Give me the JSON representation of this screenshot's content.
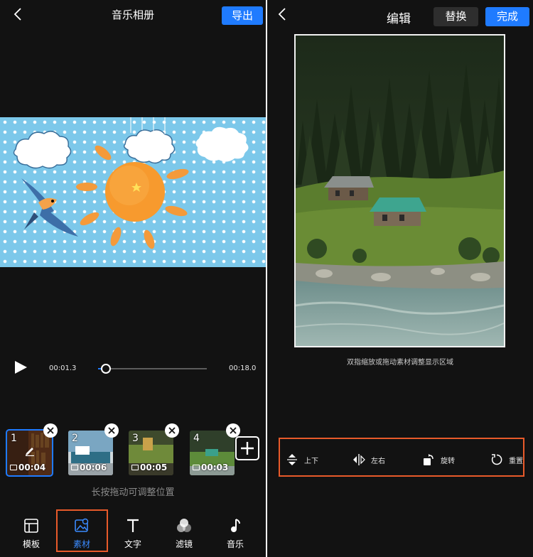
{
  "left": {
    "title": "音乐相册",
    "export_label": "导出",
    "player": {
      "current_time": "00:01.3",
      "total_time": "00:18.0",
      "progress": 0.072
    },
    "clips": [
      {
        "index": "1",
        "duration": "00:04",
        "selected": true
      },
      {
        "index": "2",
        "duration": "00:06",
        "selected": false
      },
      {
        "index": "3",
        "duration": "00:05",
        "selected": false
      },
      {
        "index": "4",
        "duration": "00:03",
        "selected": false
      }
    ],
    "hint": "长按拖动可调整位置",
    "nav": [
      {
        "label": "模板",
        "icon": "template-icon"
      },
      {
        "label": "素材",
        "icon": "media-icon",
        "active": true
      },
      {
        "label": "文字",
        "icon": "text-icon"
      },
      {
        "label": "滤镜",
        "icon": "filter-icon"
      },
      {
        "label": "音乐",
        "icon": "music-icon"
      }
    ]
  },
  "right": {
    "title": "编辑",
    "replace_label": "替换",
    "done_label": "完成",
    "hint": "双指缩放或拖动素材调整显示区域",
    "tools": [
      {
        "label": "上下",
        "icon": "flip-vertical-icon"
      },
      {
        "label": "左右",
        "icon": "flip-horizontal-icon"
      },
      {
        "label": "旋转",
        "icon": "rotate-icon"
      },
      {
        "label": "重置",
        "icon": "reset-icon"
      }
    ]
  },
  "colors": {
    "accent": "#1f7bff",
    "highlight_box": "#e85a2a",
    "background": "#121212"
  }
}
